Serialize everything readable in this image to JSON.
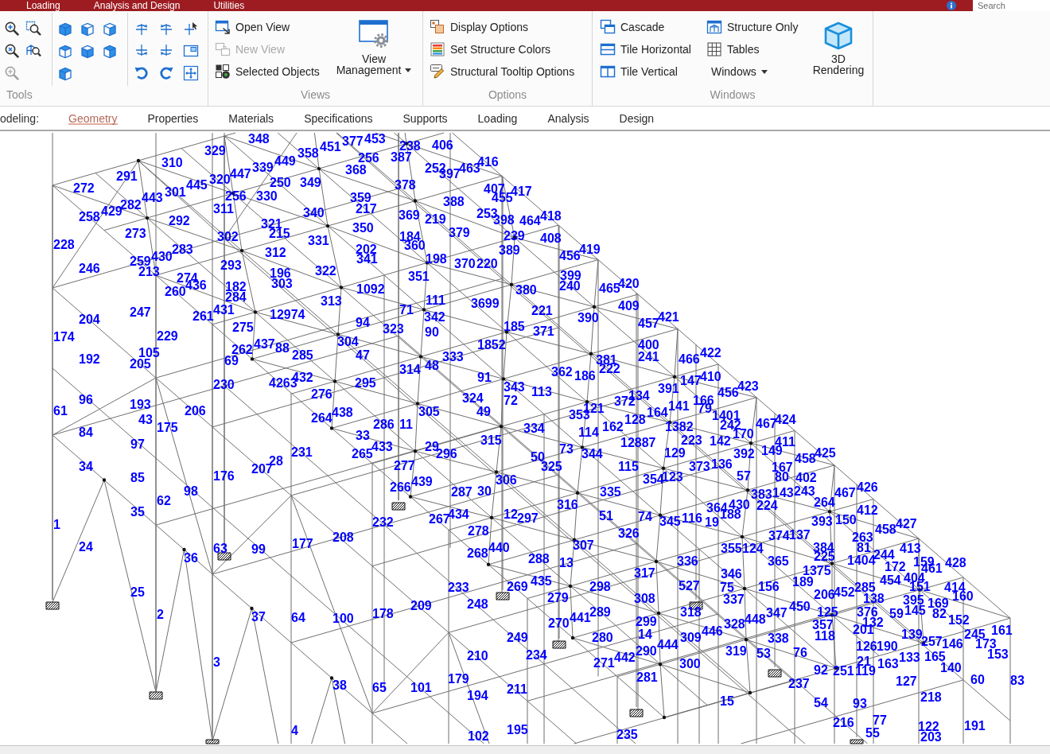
{
  "menu_bar": {
    "tabs": [
      {
        "label": "Loading"
      },
      {
        "label": "Analysis and Design"
      },
      {
        "label": "Utilities"
      }
    ],
    "search": {
      "placeholder": "Search"
    }
  },
  "ribbon": {
    "tools": {
      "label": "Tools",
      "buttons": [
        {
          "disabled": false
        },
        {
          "disabled": false
        },
        {
          "disabled": false
        },
        {
          "disabled": false
        },
        {
          "disabled": true
        },
        {
          "disabled": false
        },
        {
          "disabled": false
        },
        {
          "disabled": false
        },
        {
          "disabled": false
        },
        {
          "disabled": false
        },
        {
          "disabled": false
        },
        {
          "disabled": false
        },
        {
          "disabled": false
        },
        {
          "disabled": false
        },
        {
          "disabled": false
        },
        {
          "disabled": false
        },
        {
          "disabled": false
        },
        {
          "disabled": false
        },
        {
          "disabled": false
        },
        {
          "disabled": false
        },
        {
          "disabled": false
        }
      ]
    },
    "views": {
      "label": "Views",
      "items": [
        {
          "label": "Open View",
          "disabled": false
        },
        {
          "label": "New View",
          "disabled": true
        },
        {
          "label": "Selected Objects",
          "disabled": false
        }
      ],
      "big_button": {
        "lines": [
          "View",
          "Management"
        ],
        "dropdown": true
      }
    },
    "options": {
      "label": "Options",
      "items": [
        {
          "label": "Display Options"
        },
        {
          "label": "Set Structure Colors"
        },
        {
          "label": "Structural Tooltip Options"
        }
      ]
    },
    "windows": {
      "label": "Windows",
      "items": [
        {
          "label": "Cascade"
        },
        {
          "label": "Tile Horizontal"
        },
        {
          "label": "Tile Vertical"
        },
        {
          "label": "Structure Only"
        },
        {
          "label": "Tables"
        }
      ],
      "menu": {
        "label": "Windows",
        "dropdown": true
      },
      "big_button": {
        "lines": [
          "3D",
          "Rendering"
        ],
        "dropdown": false
      }
    }
  },
  "modeling_bar": {
    "label": "odeling:",
    "tabs": [
      {
        "label": "Geometry",
        "selected": true
      },
      {
        "label": "Properties",
        "selected": false
      },
      {
        "label": "Materials",
        "selected": false
      },
      {
        "label": "Specifications",
        "selected": false
      },
      {
        "label": "Supports",
        "selected": false
      },
      {
        "label": "Loading",
        "selected": false
      },
      {
        "label": "Analysis",
        "selected": false
      },
      {
        "label": "Design",
        "selected": false
      }
    ]
  },
  "model_view": {
    "member_numbers": [
      "348",
      "377",
      "453",
      "329",
      "451",
      "238",
      "406",
      "358",
      "256",
      "387",
      "310",
      "449",
      "416",
      "447",
      "339",
      "368",
      "252",
      "397",
      "463",
      "291",
      "320",
      "250",
      "349",
      "272",
      "445",
      "378",
      "407",
      "443",
      "301",
      "256",
      "330",
      "359",
      "455",
      "417",
      "282",
      "388",
      "258",
      "429",
      "311",
      "340",
      "217",
      "253",
      "292",
      "369",
      "219",
      "398",
      "464",
      "418",
      "321",
      "350",
      "273",
      "302",
      "215",
      "184",
      "379",
      "239",
      "408",
      "228",
      "283",
      "331",
      "360",
      "312",
      "202",
      "389",
      "419",
      "259",
      "430",
      "341",
      "198",
      "456",
      "246",
      "293",
      "370",
      "220",
      "213",
      "274",
      "196",
      "322",
      "351",
      "399",
      "436",
      "303",
      "240",
      "420",
      "260",
      "182",
      "1092",
      "380",
      "465",
      "284",
      "313",
      "111",
      "431",
      "71",
      "3699",
      "409",
      "204",
      "247",
      "261",
      "12974",
      "94",
      "342",
      "221",
      "390",
      "457",
      "421",
      "275",
      "323",
      "90",
      "185",
      "371",
      "174",
      "229",
      "304",
      "262",
      "437",
      "88",
      "1852",
      "400",
      "105",
      "285",
      "47",
      "333",
      "241",
      "422",
      "192",
      "205",
      "69",
      "48",
      "381",
      "466",
      "314",
      "362",
      "222",
      "432",
      "91",
      "186",
      "410",
      "230",
      "4263",
      "295",
      "343",
      "391",
      "147",
      "423",
      "276",
      "113",
      "134",
      "456",
      "96",
      "193",
      "324",
      "72",
      "372",
      "166",
      "61",
      "206",
      "438",
      "305",
      "49",
      "121",
      "164",
      "141",
      "79",
      "43",
      "264",
      "353",
      "128",
      "1401",
      "424",
      "175",
      "286",
      "11",
      "334",
      "162",
      "242",
      "467",
      "84",
      "33",
      "114",
      "1382",
      "223",
      "170",
      "97",
      "315",
      "12887",
      "142",
      "411",
      "231",
      "433",
      "29",
      "73",
      "129",
      "149",
      "425",
      "28",
      "265",
      "296",
      "50",
      "344",
      "392",
      "458",
      "34",
      "207",
      "277",
      "325",
      "115",
      "373",
      "136",
      "167",
      "85",
      "176",
      "439",
      "306",
      "354",
      "123",
      "57",
      "80",
      "402",
      "98",
      "266",
      "287",
      "30",
      "335",
      "143",
      "243",
      "467",
      "426",
      "62",
      "383",
      "316",
      "364",
      "430",
      "224",
      "264",
      "35",
      "434",
      "12",
      "51",
      "74",
      "188",
      "412",
      "1",
      "232",
      "267",
      "297",
      "345",
      "116",
      "19",
      "393",
      "150",
      "427",
      "278",
      "458",
      "208",
      "326",
      "374",
      "137",
      "263",
      "24",
      "63",
      "99",
      "177",
      "268",
      "440",
      "307",
      "355",
      "124",
      "384",
      "225",
      "81",
      "244",
      "413",
      "36",
      "288",
      "13",
      "336",
      "365",
      "1404",
      "172",
      "159",
      "461",
      "428",
      "317",
      "346",
      "1375",
      "189",
      "454",
      "404",
      "25",
      "233",
      "269",
      "435",
      "298",
      "527",
      "75",
      "156",
      "206",
      "452",
      "285",
      "151",
      "414",
      "160",
      "209",
      "248",
      "279",
      "308",
      "337",
      "138",
      "395",
      "169",
      "2",
      "37",
      "64",
      "100",
      "178",
      "270",
      "441",
      "289",
      "299",
      "318",
      "328",
      "448",
      "347",
      "450",
      "125",
      "357",
      "376",
      "132",
      "59",
      "145",
      "82",
      "152",
      "14",
      "446",
      "118",
      "201",
      "139",
      "245",
      "161",
      "249",
      "280",
      "309",
      "338",
      "146",
      "173",
      "210",
      "234",
      "442",
      "290",
      "444",
      "319",
      "53",
      "76",
      "126",
      "190",
      "133",
      "257",
      "165",
      "153",
      "3",
      "271",
      "300",
      "92",
      "251",
      "21",
      "119",
      "163",
      "140",
      "38",
      "65",
      "101",
      "179",
      "211",
      "281",
      "237",
      "127",
      "60",
      "83",
      "194",
      "15",
      "54",
      "93",
      "218",
      "216",
      "77",
      "4",
      "195",
      "122",
      "191",
      "102",
      "235",
      "55",
      "203"
    ]
  }
}
